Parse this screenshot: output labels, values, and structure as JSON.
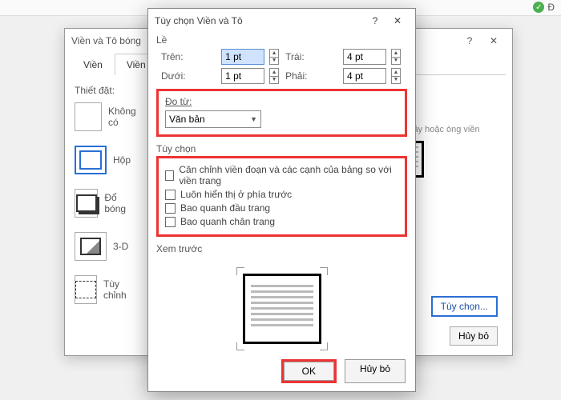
{
  "ribbon": {
    "right_text": "Đ"
  },
  "dlg1": {
    "title": "Viền và Tô bóng",
    "help": "?",
    "close": "✕",
    "tabs": [
      "Viền",
      "Viền Trang"
    ],
    "thietdat": "Thiết đặt:",
    "presets": [
      {
        "key": "none",
        "label": "Không có"
      },
      {
        "key": "box",
        "label": "Hộp"
      },
      {
        "key": "shadow",
        "label": "Đổ bóng"
      },
      {
        "key": "3d",
        "label": "3-D"
      },
      {
        "key": "custom",
        "label": "Tùy chỉnh"
      }
    ],
    "right_hint": "jầy hoặc\nòng viền",
    "tuychon_btn": "Tùy chọn...",
    "huybo": "Hủy bỏ"
  },
  "dlg2": {
    "title": "Tùy chọn Viền và Tô",
    "help": "?",
    "close": "✕",
    "le_label": "Lề",
    "margins": {
      "top_l": "Trên:",
      "top_v": "1 pt",
      "left_l": "Trái:",
      "left_v": "4 pt",
      "bottom_l": "Dưới:",
      "bottom_v": "1 pt",
      "right_l": "Phải:",
      "right_v": "4 pt"
    },
    "dotu_label": "Đo từ:",
    "dotu_value": "Văn bản",
    "tuychon_label": "Tùy chọn",
    "checks": [
      "Căn chỉnh viền đoạn và các cạnh của bảng so với viền trang",
      "Luôn hiển thị ở phía trước",
      "Bao quanh đầu trang",
      "Bao quanh chân trang"
    ],
    "xemtruoc": "Xem trước",
    "ok": "OK",
    "huybo": "Hủy bỏ"
  }
}
